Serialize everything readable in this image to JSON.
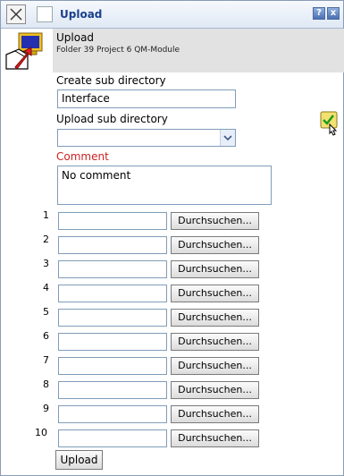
{
  "window": {
    "title": "Upload",
    "help_label": "?",
    "close_label": "x"
  },
  "header": {
    "title": "Upload",
    "subtitle": "Folder 39 Project 6 QM-Module",
    "icon": "computer-upload-icon"
  },
  "form": {
    "create_subdir_label": "Create sub directory",
    "create_subdir_value": "Interface",
    "upload_subdir_label": "Upload sub directory",
    "upload_subdir_value": "",
    "comment_label": "Comment",
    "comment_value": "No comment",
    "browse_label": "Durchsuchen...",
    "upload_button": "Upload"
  },
  "colors": {
    "comment_label": "#cc2222",
    "title_text": "#1a3f8c",
    "header_bg": "#e2e2e2"
  },
  "rows": [
    "1",
    "2",
    "3",
    "4",
    "5",
    "6",
    "7",
    "8",
    "9",
    "10"
  ]
}
